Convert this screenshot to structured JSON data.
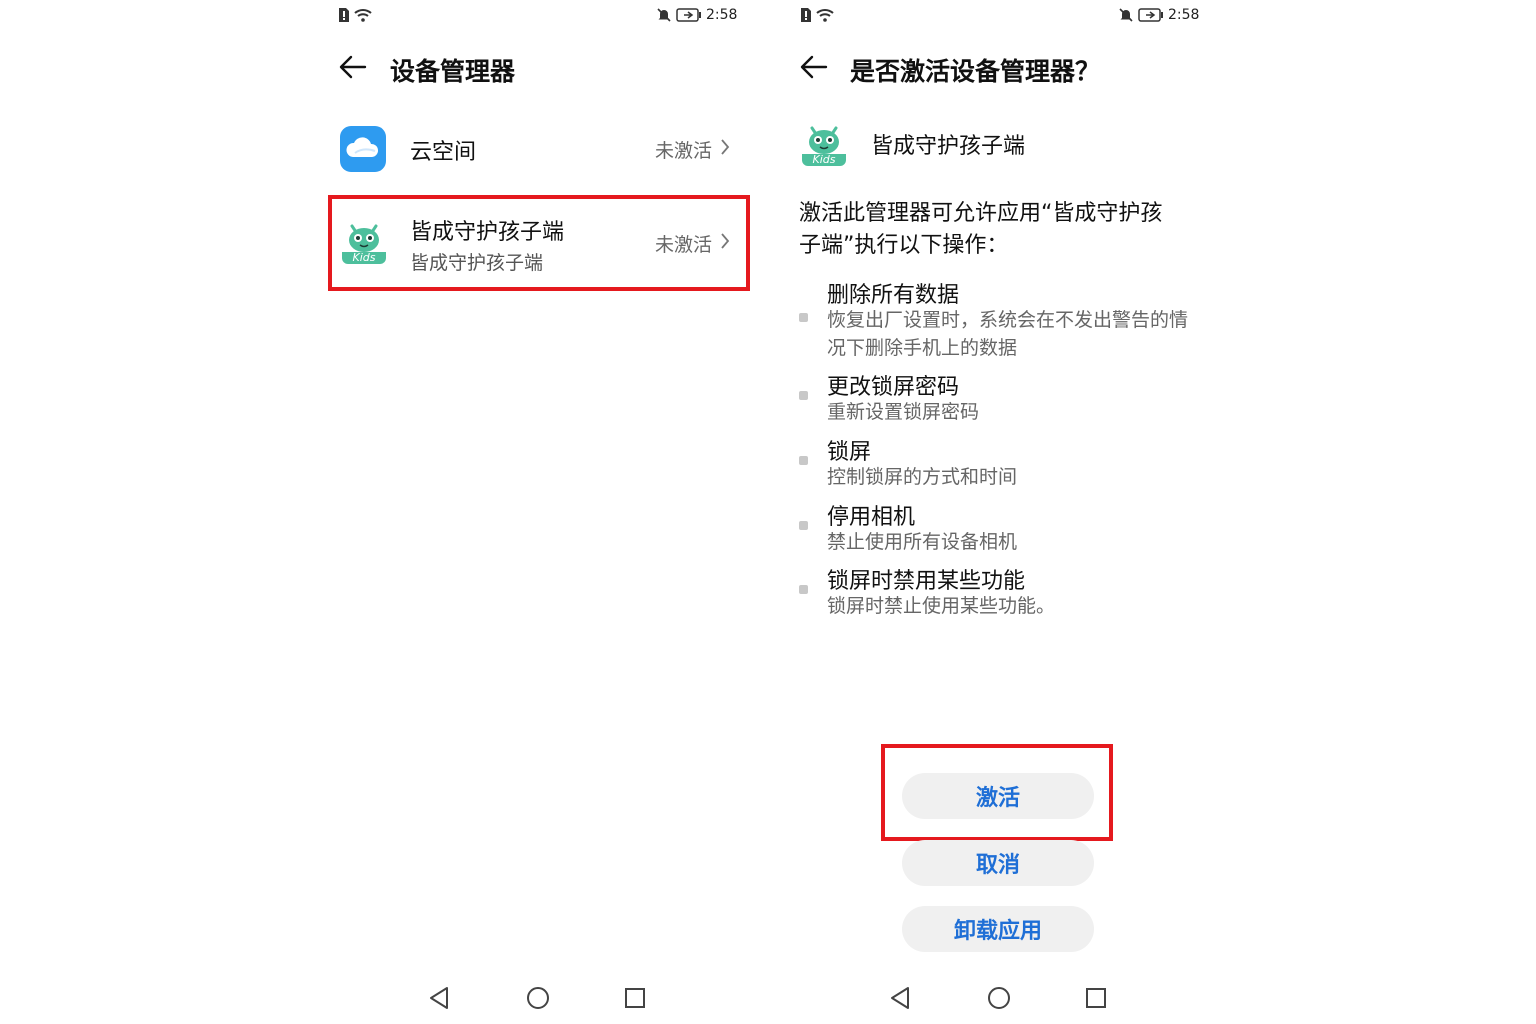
{
  "left": {
    "status": {
      "time": "2:58"
    },
    "title": "设备管理器",
    "items": [
      {
        "title": "云空间",
        "subtitle": "",
        "status": "未激活"
      },
      {
        "title": "皆成守护孩子端",
        "subtitle": "皆成守护孩子端",
        "status": "未激活"
      }
    ],
    "kids_label": "Kids"
  },
  "right": {
    "status": {
      "time": "2:58"
    },
    "title": "是否激活设备管理器？",
    "app_name": "皆成守护孩子端",
    "kids_label": "Kids",
    "description_1": "激活此管理器可允许应用“皆成守护孩",
    "description_2": "子端”执行以下操作：",
    "permissions": [
      {
        "title": "删除所有数据",
        "subtitle": "恢复出厂设置时，系统会在不发出警告的情况下删除手机上的数据"
      },
      {
        "title": "更改锁屏密码",
        "subtitle": "重新设置锁屏密码"
      },
      {
        "title": "锁屏",
        "subtitle": "控制锁屏的方式和时间"
      },
      {
        "title": "停用相机",
        "subtitle": "禁止使用所有设备相机"
      },
      {
        "title": "锁屏时禁用某些功能",
        "subtitle": "锁屏时禁止使用某些功能。"
      }
    ],
    "buttons": {
      "activate": "激活",
      "cancel": "取消",
      "uninstall": "卸载应用"
    }
  },
  "colors": {
    "accent": "#1f6fd6",
    "highlight": "#e5191e",
    "cloud_icon": "#2e9bf0",
    "kids_icon": "#4dbf9c"
  },
  "icons": [
    "sim-alert-icon",
    "wifi-icon",
    "mute-bell-icon",
    "battery-charging-icon",
    "back-arrow-icon",
    "chevron-right-icon",
    "cloud-app-icon",
    "kids-app-icon",
    "nav-back-icon",
    "nav-home-icon",
    "nav-recent-icon"
  ]
}
